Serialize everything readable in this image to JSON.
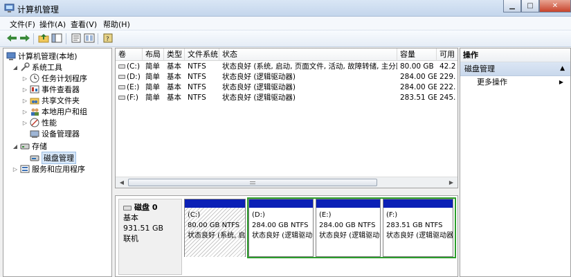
{
  "window": {
    "title": "计算机管理"
  },
  "menu": [
    "文件(F)",
    "操作(A)",
    "查看(V)",
    "帮助(H)"
  ],
  "toolbar": {
    "icons": [
      "back-arrow-icon",
      "forward-arrow-icon",
      "up-folder-icon",
      "show-hide-tree-icon",
      "help-book-icon",
      "properties-icon"
    ]
  },
  "tree": {
    "root": "计算机管理(本地)",
    "system_tools": "系统工具",
    "task_scheduler": "任务计划程序",
    "event_viewer": "事件查看器",
    "shared_folders": "共享文件夹",
    "local_users": "本地用户和组",
    "performance": "性能",
    "device_manager": "设备管理器",
    "storage": "存储",
    "disk_management": "磁盘管理",
    "services_apps": "服务和应用程序"
  },
  "volumes": {
    "columns": [
      "卷",
      "布局",
      "类型",
      "文件系统",
      "状态",
      "容量",
      "可用"
    ],
    "rows": [
      [
        "(C:)",
        "简单",
        "基本",
        "NTFS",
        "状态良好 (系统, 启动, 页面文件, 活动, 故障转储, 主分区)",
        "80.00 GB",
        "42.2"
      ],
      [
        "(D:)",
        "简单",
        "基本",
        "NTFS",
        "状态良好 (逻辑驱动器)",
        "284.00 GB",
        "229."
      ],
      [
        "(E:)",
        "简单",
        "基本",
        "NTFS",
        "状态良好 (逻辑驱动器)",
        "284.00 GB",
        "222."
      ],
      [
        "(F:)",
        "简单",
        "基本",
        "NTFS",
        "状态良好 (逻辑驱动器)",
        "283.51 GB",
        "245."
      ]
    ]
  },
  "disk": {
    "name": "磁盘 0",
    "type": "基本",
    "size": "931.51 GB",
    "status": "联机",
    "partitions": [
      {
        "label": "(C:)",
        "size": "80.00 GB NTFS",
        "status": "状态良好 (系统, 启"
      },
      {
        "label": "(D:)",
        "size": "284.00 GB NTFS",
        "status": "状态良好 (逻辑驱动器)"
      },
      {
        "label": "(E:)",
        "size": "284.00 GB NTFS",
        "status": "状态良好 (逻辑驱动器)"
      },
      {
        "label": "(F:)",
        "size": "283.51 GB NTFS",
        "status": "状态良好 (逻辑驱动器)"
      }
    ]
  },
  "actions": {
    "header": "操作",
    "section": "磁盘管理",
    "more": "更多操作"
  },
  "colors": {
    "partition_band": "#0b20b6",
    "extended_border": "#2b9d2b",
    "selection": "#d6e6f8"
  }
}
